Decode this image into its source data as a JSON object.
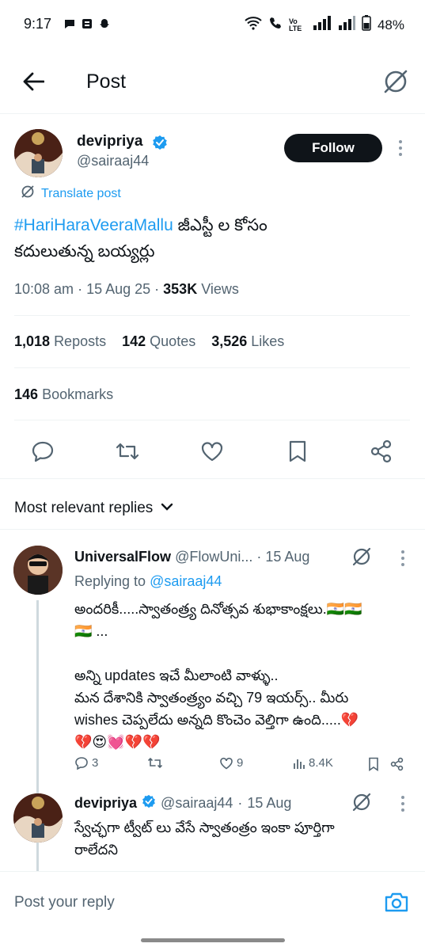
{
  "status_bar": {
    "time": "9:17",
    "battery": "48%",
    "network_label": "Vo LTE"
  },
  "header": {
    "title": "Post",
    "back_icon": "arrow-left-icon",
    "translate_icon": "no-translate-icon"
  },
  "tweet": {
    "author_name": "devipriya",
    "handle": "@sairaaj44",
    "follow_label": "Follow",
    "translate_label": "Translate post",
    "hashtag": "#HariHaraVeeraMallu",
    "text_after_hashtag": " జీఎస్టీ ల కోసం",
    "text_line2": "కదులుతున్న బయ్యర్లు",
    "time": "10:08 am",
    "date": "15 Aug 25",
    "views_count": "353K",
    "views_label": "Views",
    "reposts_count": "1,018",
    "reposts_label": "Reposts",
    "quotes_count": "142",
    "quotes_label": "Quotes",
    "likes_count": "3,526",
    "likes_label": "Likes",
    "bookmarks_count": "146",
    "bookmarks_label": "Bookmarks"
  },
  "replies_sort": {
    "label": "Most relevant replies"
  },
  "replies": [
    {
      "name": "UniversalFlow",
      "handle": "@FlowUni...",
      "date": "15 Aug",
      "replying_to_label": "Replying to",
      "replying_to_handle": "@sairaaj44",
      "line1": "అందరికీ.....స్వాతంత్ర్య దినోత్సవ శుభాకాంక్షలు.🇮🇳🇮🇳",
      "line2": "🇮🇳 ...",
      "line3": "అన్ని updates ఇచే మీలాంటి వాళ్ళు..",
      "line4": "మన దేశానికి స్వాతంత్ర్యం వచ్చి 79 ఇయర్స్.. మీరు",
      "line5": "wishes చెప్పలేదు అన్నది కొంచెం వెల్తిగా ఉంది.....💔",
      "line6": "💔😍💓💔💔",
      "reply_count": "3",
      "like_count": "9",
      "view_count": "8.4K"
    },
    {
      "name": "devipriya",
      "handle": "@sairaaj44",
      "date": "15 Aug",
      "line1": "స్వేచ్ఛగా ట్వీట్ లు వేసే స్వాతంత్రం ఇంకా పూర్తిగా",
      "line2": "రాలేదని"
    }
  ],
  "composer": {
    "placeholder": "Post your reply"
  },
  "colors": {
    "accent": "#1d9bf0",
    "text": "#0f1419",
    "muted": "#536471",
    "verified": "#1d9bf0"
  }
}
